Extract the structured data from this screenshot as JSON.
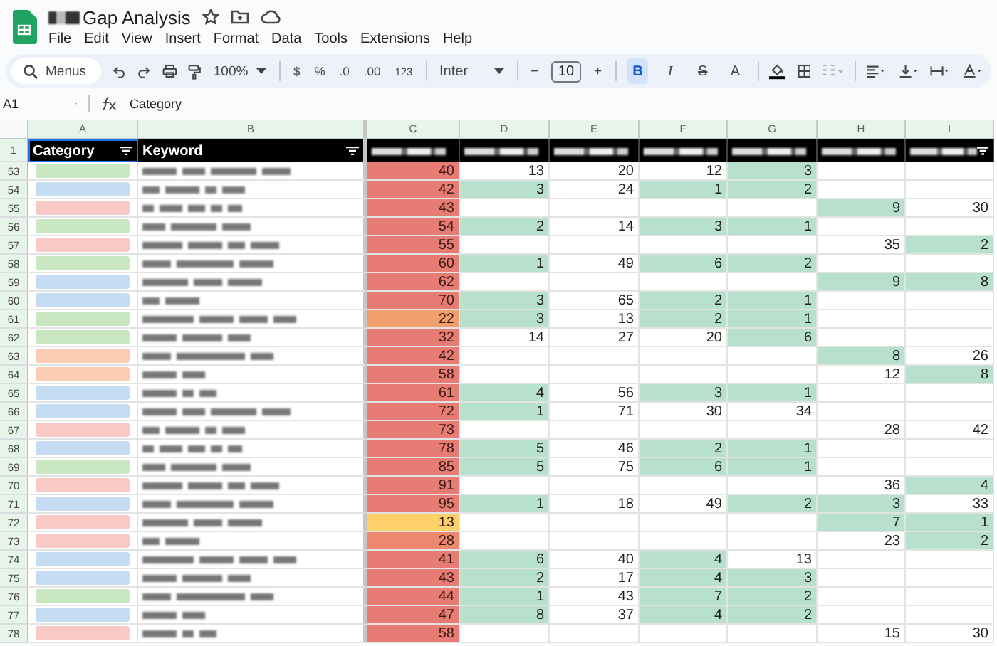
{
  "document": {
    "title": "Gap Analysis"
  },
  "menu": [
    "File",
    "Edit",
    "View",
    "Insert",
    "Format",
    "Data",
    "Tools",
    "Extensions",
    "Help"
  ],
  "toolbar": {
    "search_placeholder": "Menus",
    "zoom": "100%",
    "currency": "$",
    "percent": "%",
    "decrease_decimals": ".0",
    "increase_decimals": ".00",
    "number_format": "123",
    "font": "Inter",
    "font_size_decrease": "−",
    "font_size": "10",
    "font_size_increase": "+",
    "format_buttons": [
      {
        "label": "B",
        "kind": "bold",
        "selected": true
      },
      {
        "label": "I",
        "kind": "italic",
        "selected": false
      },
      {
        "label": "S",
        "kind": "strike",
        "selected": false
      },
      {
        "label": "A",
        "kind": "color",
        "selected": false
      }
    ]
  },
  "formula_bar": {
    "cell_ref": "A1",
    "formula": "Category"
  },
  "columns": [
    "A",
    "B",
    "C",
    "D",
    "E",
    "F",
    "G",
    "H",
    "I"
  ],
  "header_row": {
    "number": "1",
    "category": "Category",
    "keyword": "Keyword"
  },
  "rows": [
    {
      "number": "53",
      "category": {
        "color": "#c9e8c1"
      },
      "score": {
        "value": "40",
        "color": "#e67c73"
      },
      "cells": [
        {
          "value": "13",
          "highlighted": false
        },
        {
          "value": "20",
          "highlighted": false
        },
        {
          "value": "12",
          "highlighted": false
        },
        {
          "value": "3",
          "highlighted": true
        },
        {
          "highlighted": false
        },
        {
          "highlighted": false
        }
      ]
    },
    {
      "number": "54",
      "category": {
        "color": "#c5dcf3"
      },
      "score": {
        "value": "42",
        "color": "#e67c73"
      },
      "cells": [
        {
          "value": "3",
          "highlighted": true
        },
        {
          "value": "24",
          "highlighted": false
        },
        {
          "value": "1",
          "highlighted": true
        },
        {
          "value": "2",
          "highlighted": true
        },
        {
          "highlighted": false
        },
        {
          "highlighted": false
        }
      ]
    },
    {
      "number": "55",
      "category": {
        "color": "#f9c9c6"
      },
      "score": {
        "value": "43",
        "color": "#e67c73"
      },
      "cells": [
        {
          "highlighted": false
        },
        {
          "highlighted": false
        },
        {
          "highlighted": false
        },
        {
          "highlighted": false
        },
        {
          "value": "9",
          "highlighted": true
        },
        {
          "value": "30",
          "highlighted": false
        }
      ]
    },
    {
      "number": "56",
      "category": {
        "color": "#c9e8c1"
      },
      "score": {
        "value": "54",
        "color": "#e67c73"
      },
      "cells": [
        {
          "value": "2",
          "highlighted": true
        },
        {
          "value": "14",
          "highlighted": false
        },
        {
          "value": "3",
          "highlighted": true
        },
        {
          "value": "1",
          "highlighted": true
        },
        {
          "highlighted": false
        },
        {
          "highlighted": false
        }
      ]
    },
    {
      "number": "57",
      "category": {
        "color": "#f9c9c6"
      },
      "score": {
        "value": "55",
        "color": "#e67c73"
      },
      "cells": [
        {
          "highlighted": false
        },
        {
          "highlighted": false
        },
        {
          "highlighted": false
        },
        {
          "highlighted": false
        },
        {
          "value": "35",
          "highlighted": false
        },
        {
          "value": "2",
          "highlighted": true
        }
      ]
    },
    {
      "number": "58",
      "category": {
        "color": "#c9e8c1"
      },
      "score": {
        "value": "60",
        "color": "#e67c73"
      },
      "cells": [
        {
          "value": "1",
          "highlighted": true
        },
        {
          "value": "49",
          "highlighted": false
        },
        {
          "value": "6",
          "highlighted": true
        },
        {
          "value": "2",
          "highlighted": true
        },
        {
          "highlighted": false
        },
        {
          "highlighted": false
        }
      ]
    },
    {
      "number": "59",
      "category": {
        "color": "#c5dcf3"
      },
      "score": {
        "value": "62",
        "color": "#e67c73"
      },
      "cells": [
        {
          "highlighted": false
        },
        {
          "highlighted": false
        },
        {
          "highlighted": false
        },
        {
          "highlighted": false
        },
        {
          "value": "9",
          "highlighted": true
        },
        {
          "value": "8",
          "highlighted": true
        }
      ]
    },
    {
      "number": "60",
      "category": {
        "color": "#c5dcf3"
      },
      "score": {
        "value": "70",
        "color": "#e67c73"
      },
      "cells": [
        {
          "value": "3",
          "highlighted": true
        },
        {
          "value": "65",
          "highlighted": false
        },
        {
          "value": "2",
          "highlighted": true
        },
        {
          "value": "1",
          "highlighted": true
        },
        {
          "highlighted": false
        },
        {
          "highlighted": false
        }
      ]
    },
    {
      "number": "61",
      "category": {
        "color": "#c9e8c1"
      },
      "score": {
        "value": "22",
        "color": "#f0a06c"
      },
      "cells": [
        {
          "value": "3",
          "highlighted": true
        },
        {
          "value": "13",
          "highlighted": false
        },
        {
          "value": "2",
          "highlighted": true
        },
        {
          "value": "1",
          "highlighted": true
        },
        {
          "highlighted": false
        },
        {
          "highlighted": false
        }
      ]
    },
    {
      "number": "62",
      "category": {
        "color": "#c9e8c1"
      },
      "score": {
        "value": "32",
        "color": "#e67c73"
      },
      "cells": [
        {
          "value": "14",
          "highlighted": false
        },
        {
          "value": "27",
          "highlighted": false
        },
        {
          "value": "20",
          "highlighted": false
        },
        {
          "value": "6",
          "highlighted": true
        },
        {
          "highlighted": false
        },
        {
          "highlighted": false
        }
      ]
    },
    {
      "number": "63",
      "category": {
        "color": "#fbcbb3"
      },
      "score": {
        "value": "42",
        "color": "#e67c73"
      },
      "cells": [
        {
          "highlighted": false
        },
        {
          "highlighted": false
        },
        {
          "highlighted": false
        },
        {
          "highlighted": false
        },
        {
          "value": "8",
          "highlighted": true
        },
        {
          "value": "26",
          "highlighted": false
        }
      ]
    },
    {
      "number": "64",
      "category": {
        "color": "#fbcbb3"
      },
      "score": {
        "value": "58",
        "color": "#e67c73"
      },
      "cells": [
        {
          "highlighted": false
        },
        {
          "highlighted": false
        },
        {
          "highlighted": false
        },
        {
          "highlighted": false
        },
        {
          "value": "12",
          "highlighted": false
        },
        {
          "value": "8",
          "highlighted": true
        }
      ]
    },
    {
      "number": "65",
      "category": {
        "color": "#c5dcf3"
      },
      "score": {
        "value": "61",
        "color": "#e67c73"
      },
      "cells": [
        {
          "value": "4",
          "highlighted": true
        },
        {
          "value": "56",
          "highlighted": false
        },
        {
          "value": "3",
          "highlighted": true
        },
        {
          "value": "1",
          "highlighted": true
        },
        {
          "highlighted": false
        },
        {
          "highlighted": false
        }
      ]
    },
    {
      "number": "66",
      "category": {
        "color": "#c5dcf3"
      },
      "score": {
        "value": "72",
        "color": "#e67c73"
      },
      "cells": [
        {
          "value": "1",
          "highlighted": true
        },
        {
          "value": "71",
          "highlighted": false
        },
        {
          "value": "30",
          "highlighted": false
        },
        {
          "value": "34",
          "highlighted": false
        },
        {
          "highlighted": false
        },
        {
          "highlighted": false
        }
      ]
    },
    {
      "number": "67",
      "category": {
        "color": "#f9c9c6"
      },
      "score": {
        "value": "73",
        "color": "#e67c73"
      },
      "cells": [
        {
          "highlighted": false
        },
        {
          "highlighted": false
        },
        {
          "highlighted": false
        },
        {
          "highlighted": false
        },
        {
          "value": "28",
          "highlighted": false
        },
        {
          "value": "42",
          "highlighted": false
        }
      ]
    },
    {
      "number": "68",
      "category": {
        "color": "#c5dcf3"
      },
      "score": {
        "value": "78",
        "color": "#e67c73"
      },
      "cells": [
        {
          "value": "5",
          "highlighted": true
        },
        {
          "value": "46",
          "highlighted": false
        },
        {
          "value": "2",
          "highlighted": true
        },
        {
          "value": "1",
          "highlighted": true
        },
        {
          "highlighted": false
        },
        {
          "highlighted": false
        }
      ]
    },
    {
      "number": "69",
      "category": {
        "color": "#c9e8c1"
      },
      "score": {
        "value": "85",
        "color": "#e67c73"
      },
      "cells": [
        {
          "value": "5",
          "highlighted": true
        },
        {
          "value": "75",
          "highlighted": false
        },
        {
          "value": "6",
          "highlighted": true
        },
        {
          "value": "1",
          "highlighted": true
        },
        {
          "highlighted": false
        },
        {
          "highlighted": false
        }
      ]
    },
    {
      "number": "70",
      "category": {
        "color": "#f9c9c6"
      },
      "score": {
        "value": "91",
        "color": "#e67c73"
      },
      "cells": [
        {
          "highlighted": false
        },
        {
          "highlighted": false
        },
        {
          "highlighted": false
        },
        {
          "highlighted": false
        },
        {
          "value": "36",
          "highlighted": false
        },
        {
          "value": "4",
          "highlighted": true
        }
      ]
    },
    {
      "number": "71",
      "category": {
        "color": "#c5dcf3"
      },
      "score": {
        "value": "95",
        "color": "#e67c73"
      },
      "cells": [
        {
          "value": "1",
          "highlighted": true
        },
        {
          "value": "18",
          "highlighted": false
        },
        {
          "value": "49",
          "highlighted": false
        },
        {
          "value": "2",
          "highlighted": true
        },
        {
          "value": "3",
          "highlighted": true
        },
        {
          "value": "33",
          "highlighted": false
        }
      ]
    },
    {
      "number": "72",
      "category": {
        "color": "#f9c9c6"
      },
      "score": {
        "value": "13",
        "color": "#fdd06a"
      },
      "cells": [
        {
          "highlighted": false
        },
        {
          "highlighted": false
        },
        {
          "highlighted": false
        },
        {
          "highlighted": false
        },
        {
          "value": "7",
          "highlighted": true
        },
        {
          "value": "1",
          "highlighted": true
        }
      ]
    },
    {
      "number": "73",
      "category": {
        "color": "#f9c9c6"
      },
      "score": {
        "value": "28",
        "color": "#ec8870"
      },
      "cells": [
        {
          "highlighted": false
        },
        {
          "highlighted": false
        },
        {
          "highlighted": false
        },
        {
          "highlighted": false
        },
        {
          "value": "23",
          "highlighted": false
        },
        {
          "value": "2",
          "highlighted": true
        }
      ]
    },
    {
      "number": "74",
      "category": {
        "color": "#c5dcf3"
      },
      "score": {
        "value": "41",
        "color": "#e67c73"
      },
      "cells": [
        {
          "value": "6",
          "highlighted": true
        },
        {
          "value": "40",
          "highlighted": false
        },
        {
          "value": "4",
          "highlighted": true
        },
        {
          "value": "13",
          "highlighted": false
        },
        {
          "highlighted": false
        },
        {
          "highlighted": false
        }
      ]
    },
    {
      "number": "75",
      "category": {
        "color": "#c5dcf3"
      },
      "score": {
        "value": "43",
        "color": "#e67c73"
      },
      "cells": [
        {
          "value": "2",
          "highlighted": true
        },
        {
          "value": "17",
          "highlighted": false
        },
        {
          "value": "4",
          "highlighted": true
        },
        {
          "value": "3",
          "highlighted": true
        },
        {
          "highlighted": false
        },
        {
          "highlighted": false
        }
      ]
    },
    {
      "number": "76",
      "category": {
        "color": "#c9e8c1"
      },
      "score": {
        "value": "44",
        "color": "#e67c73"
      },
      "cells": [
        {
          "value": "1",
          "highlighted": true
        },
        {
          "value": "43",
          "highlighted": false
        },
        {
          "value": "7",
          "highlighted": true
        },
        {
          "value": "2",
          "highlighted": true
        },
        {
          "highlighted": false
        },
        {
          "highlighted": false
        }
      ]
    },
    {
      "number": "77",
      "category": {
        "color": "#c5dcf3"
      },
      "score": {
        "value": "47",
        "color": "#e67c73"
      },
      "cells": [
        {
          "value": "8",
          "highlighted": true
        },
        {
          "value": "37",
          "highlighted": false
        },
        {
          "value": "4",
          "highlighted": true
        },
        {
          "value": "2",
          "highlighted": true
        },
        {
          "highlighted": false
        },
        {
          "highlighted": false
        }
      ]
    },
    {
      "number": "78",
      "category": {
        "color": "#f9c9c6"
      },
      "score": {
        "value": "58",
        "color": "#e67c73"
      },
      "cells": [
        {
          "highlighted": false
        },
        {
          "highlighted": false
        },
        {
          "highlighted": false
        },
        {
          "highlighted": false
        },
        {
          "value": "15",
          "highlighted": false
        },
        {
          "value": "30",
          "highlighted": false
        }
      ]
    }
  ]
}
